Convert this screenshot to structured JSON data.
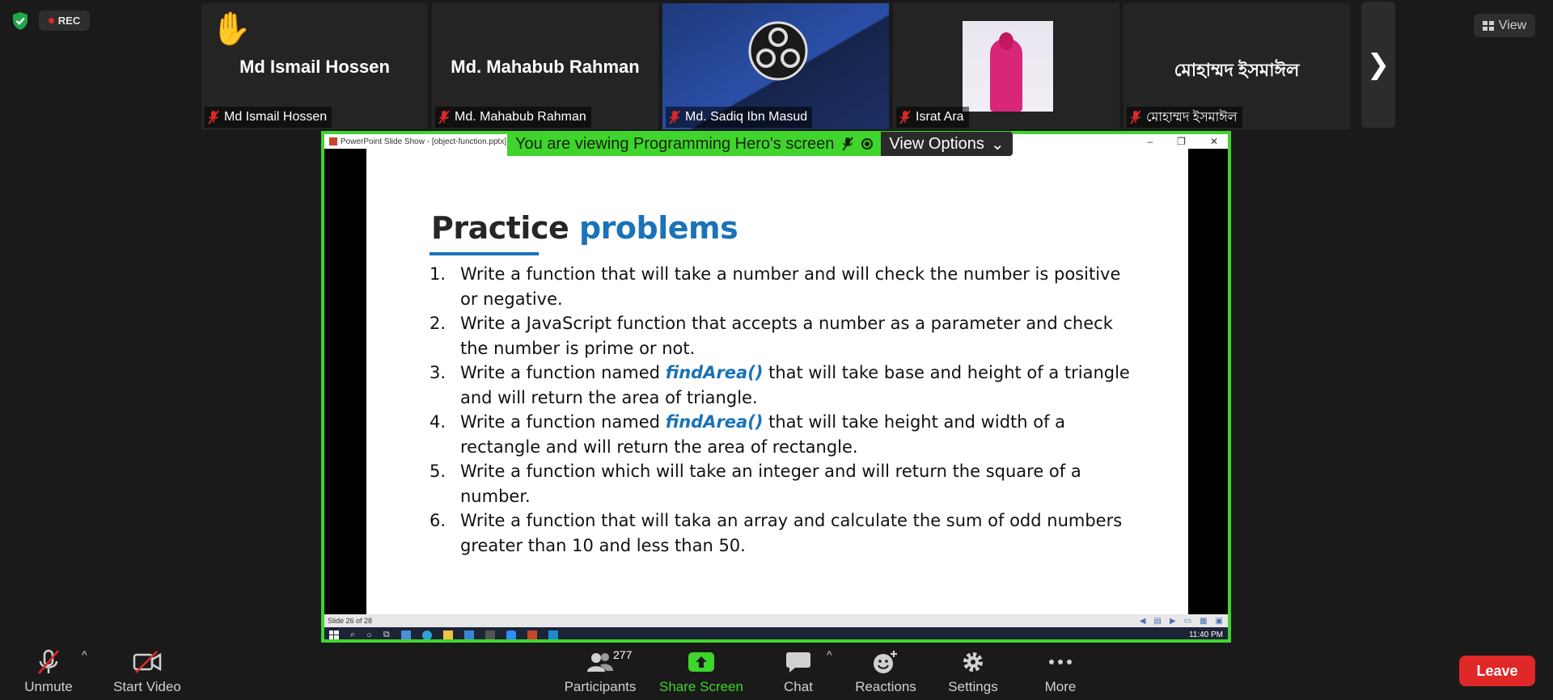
{
  "status": {
    "rec_label": "REC",
    "view_label": "View"
  },
  "participants": [
    {
      "big_name": "Md Ismail Hossen",
      "tag": "Md Ismail Hossen",
      "hand_raised": true
    },
    {
      "big_name": "Md. Mahabub Rahman",
      "tag": "Md. Mahabub Rahman"
    },
    {
      "big_name": "",
      "tag": "Md. Sadiq Ibn Masud"
    },
    {
      "big_name": "",
      "tag": "Israt Ara"
    },
    {
      "big_name": "মোহাম্মদ ইসমাঈল",
      "tag": "মোহাম্মদ ইসমাঈল"
    }
  ],
  "share": {
    "window_title": "PowerPoint Slide Show - [object-function.pptx]",
    "banner_text": "You are viewing Programming Hero's screen",
    "view_options": "View Options",
    "slide_status": "Slide 26 of 28",
    "clock": "11:40 PM"
  },
  "slide": {
    "title_part1": "Practice",
    "title_part2": "problems",
    "problems": [
      {
        "num": "1.",
        "pre": "Write a function that will take a number and will check the number is positive or negative.",
        "fn": "",
        "post": ""
      },
      {
        "num": "2.",
        "pre": "Write a JavaScript function that accepts a number as a parameter and check the number is prime or not.",
        "fn": "",
        "post": ""
      },
      {
        "num": "3.",
        "pre": "Write a function named ",
        "fn": "findArea()",
        "post": " that will take base and height of a triangle and will return the area of triangle."
      },
      {
        "num": "4.",
        "pre": "Write a function named ",
        "fn": "findArea()",
        "post": " that will take height and width of a rectangle and will return the area of rectangle."
      },
      {
        "num": "5.",
        "pre": "Write a function which will take an integer and will return the square of a number.",
        "fn": "",
        "post": ""
      },
      {
        "num": "6.",
        "pre": "Write a function that will taka an array and calculate the sum of odd numbers greater than 10 and less than 50.",
        "fn": "",
        "post": ""
      }
    ]
  },
  "toolbar": {
    "unmute": "Unmute",
    "start_video": "Start Video",
    "participants": "Participants",
    "participants_count": "277",
    "share_screen": "Share Screen",
    "chat": "Chat",
    "reactions": "Reactions",
    "settings": "Settings",
    "more": "More",
    "leave": "Leave"
  },
  "colors": {
    "share_border": "#3fd52c",
    "leave": "#e02828",
    "slide_accent": "#1a72b8"
  }
}
